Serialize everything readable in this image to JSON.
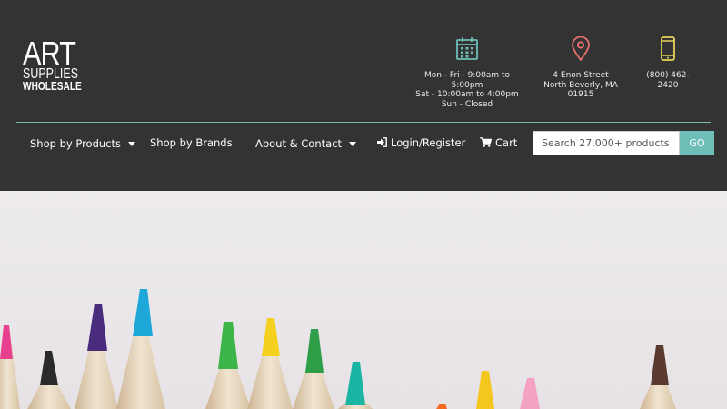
{
  "logo": {
    "line1": "ART",
    "line2": "SUPPLIES",
    "line3": "WHOLESALE"
  },
  "info": {
    "hours": {
      "icon": "calendar-icon",
      "line1": "Mon - Fri - 9:00am to 5:00pm",
      "line2": "Sat - 10:00am to 4:00pm",
      "line3": "Sun - Closed",
      "color": "#6dbfb8"
    },
    "address": {
      "icon": "map-pin-icon",
      "line1": "4 Enon Street",
      "line2": "North Beverly, MA 01915",
      "color": "#e8706a"
    },
    "phone": {
      "icon": "mobile-phone-icon",
      "line1": "(800) 462-2420",
      "color": "#e6d35a"
    }
  },
  "nav": {
    "products": "Shop by Products",
    "brands": "Shop by Brands",
    "about": "About & Contact",
    "login": "Login/Register",
    "cart": "Cart"
  },
  "search": {
    "placeholder": "Search 27,000+ products",
    "button": "GO"
  },
  "colors": {
    "header_bg": "#333333",
    "accent": "#6dbfb8",
    "hero_bg": "#ebe8eb"
  }
}
